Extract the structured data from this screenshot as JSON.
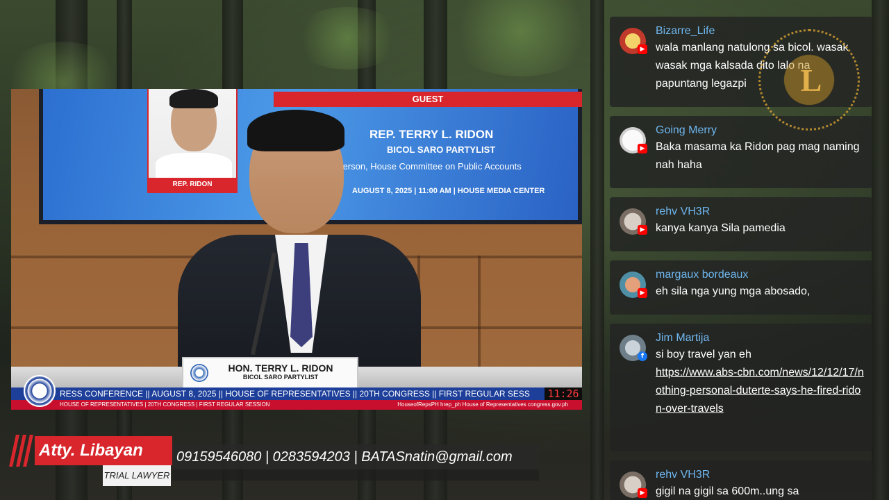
{
  "stream": {
    "guest_bar": "GUEST",
    "guest_name": "REP. TERRY L. RIDON",
    "guest_party": "BICOL SARO PARTYLIST",
    "guest_role": "rperson, House Committee on Public Accounts",
    "guest_date": "AUGUST 8, 2025  |  11:00 AM  |  HOUSE MEDIA CENTER",
    "photo_label": "REP. RIDON",
    "nameplate_name": "HON. TERRY L. RIDON",
    "nameplate_party": "BICOL SARO PARTYLIST",
    "ticker_top": "RESS CONFERENCE || AUGUST 8, 2025 || HOUSE OF REPRESENTATIVES || 20TH CONGRESS || FIRST REGULAR SESS",
    "ticker_bottom_left": "HOUSE OF REPRESENTATIVES  |  20TH CONGRESS  |  FIRST REGULAR SESSION",
    "ticker_bottom_right": "HouseofRepsPH   hrep_ph   House of Representatives   congress.gov.ph",
    "clock": "11:26"
  },
  "lower_third": {
    "name": "Atty. Libayan",
    "title": "TRIAL LAWYER",
    "contact": "09159546080 | 0283594203 | BATASnatin@gmail.com"
  },
  "chat": {
    "messages": [
      {
        "author": "Bizarre_Life",
        "platform": "youtube",
        "text": "wala manlang natulong sa bicol. wasak wasak mga kalsada dito lalo na papuntang legazpi",
        "avatar_color": "#c0392b"
      },
      {
        "author": "Going Merry",
        "platform": "youtube",
        "text": "Baka masama ka Ridon pag mag naming nah haha",
        "avatar_color": "#e8e8e8"
      },
      {
        "author": "rehv VH3R",
        "platform": "youtube",
        "text": "kanya kanya Sila pamedia",
        "avatar_color": "#9a8f86"
      },
      {
        "author": "margaux bordeaux",
        "platform": "youtube",
        "text": "eh sila nga yung mga abosado,",
        "avatar_color": "#4f8fa5"
      },
      {
        "author": "Jim Martija",
        "platform": "facebook",
        "text": "si boy travel yan eh",
        "link": "https://www.abs-cbn.com/news/12/12/17/nothing-personal-duterte-says-he-fired-ridon-over-travels",
        "avatar_color": "#6f7f8a"
      },
      {
        "author": "rehv VH3R",
        "platform": "youtube",
        "text": "gigil na gigil sa 600m..ung sa",
        "avatar_color": "#9a8f86"
      }
    ]
  },
  "watermark": {
    "letter": "L"
  }
}
